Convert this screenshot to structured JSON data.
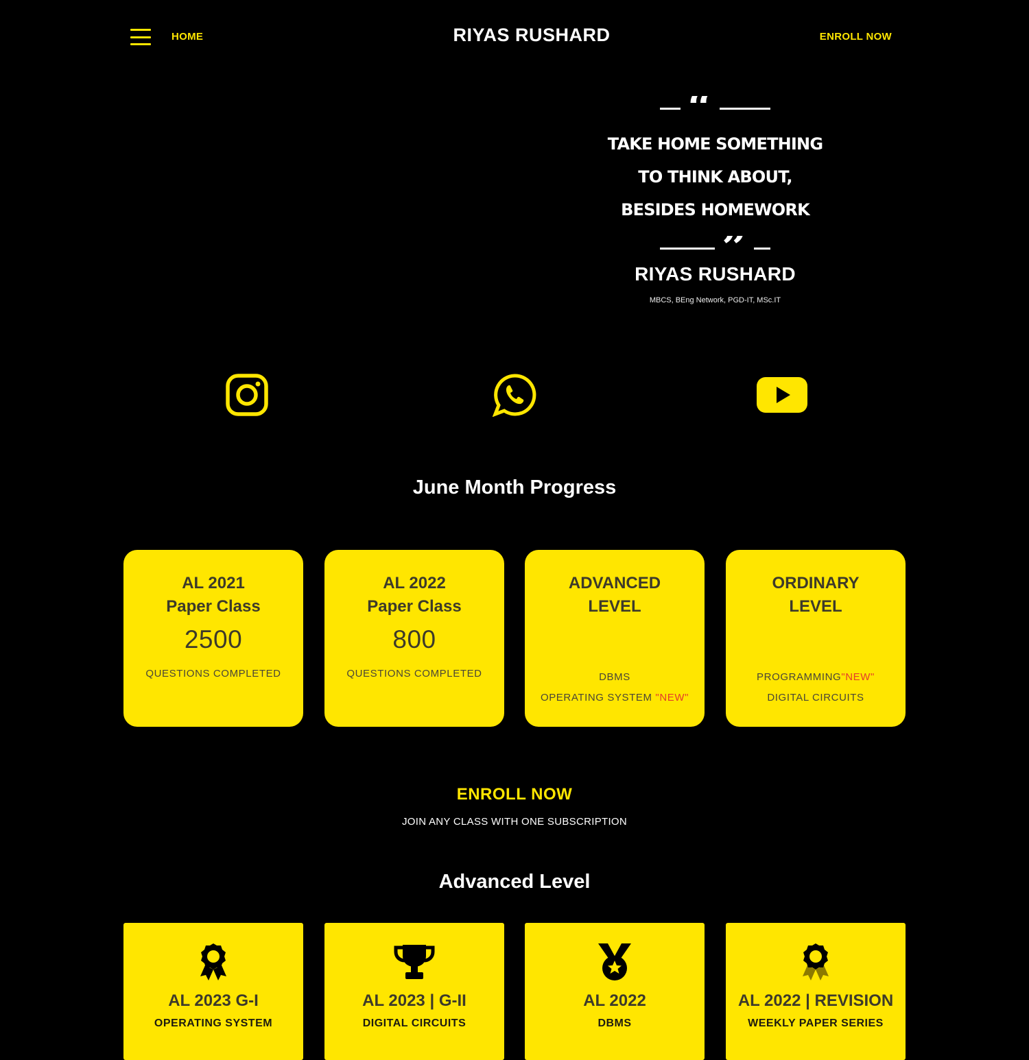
{
  "colors": {
    "accent": "#ffe600",
    "background": "#000000",
    "new_tag": "#e53b2a"
  },
  "header": {
    "menu_icon": "hamburger-icon",
    "home_label": "HOME",
    "brand": "RIYAS RUSHARD",
    "enroll_label": "ENROLL NOW"
  },
  "quote": {
    "lines": [
      "TAKE HOME SOMETHING",
      "TO THINK ABOUT,",
      "BESIDES HOMEWORK"
    ],
    "author": "RIYAS RUSHARD",
    "credentials": "MBCS, BEng Network, PGD-IT, MSc.IT"
  },
  "social": [
    {
      "icon": "instagram-icon"
    },
    {
      "icon": "whatsapp-icon"
    },
    {
      "icon": "youtube-icon"
    }
  ],
  "progress": {
    "title": "June Month Progress",
    "cards": [
      {
        "title1": "AL 2021",
        "title2": "Paper Class",
        "number": "2500",
        "sub": "QUESTIONS COMPLETED"
      },
      {
        "title1": "AL 2022",
        "title2": "Paper Class",
        "number": "800",
        "sub": "QUESTIONS COMPLETED"
      },
      {
        "title1": "ADVANCED",
        "title2": "LEVEL",
        "line1": "DBMS",
        "line2": "OPERATING SYSTEM ",
        "line2_new": "\"NEW\""
      },
      {
        "title1": "ORDINARY",
        "title2": "LEVEL",
        "line1": "PROGRAMMING",
        "line1_new": "\"NEW\"",
        "line2": "DIGITAL CIRCUITS"
      }
    ]
  },
  "enroll": {
    "title": "ENROLL NOW",
    "subtitle": "JOIN ANY CLASS WITH ONE SUBSCRIPTION"
  },
  "advanced": {
    "title": "Advanced Level",
    "courses": [
      {
        "icon": "award-ribbon-icon",
        "title": "AL 2023 G-I",
        "subtitle": "OPERATING SYSTEM"
      },
      {
        "icon": "trophy-icon",
        "title": "AL 2023 | G-II",
        "subtitle": "DIGITAL CIRCUITS"
      },
      {
        "icon": "star-medal-icon",
        "title": "AL 2022",
        "subtitle": "DBMS"
      },
      {
        "icon": "award-ribbon-icon",
        "title": "AL 2022 | REVISION",
        "subtitle": "WEEKLY PAPER SERIES"
      }
    ]
  }
}
